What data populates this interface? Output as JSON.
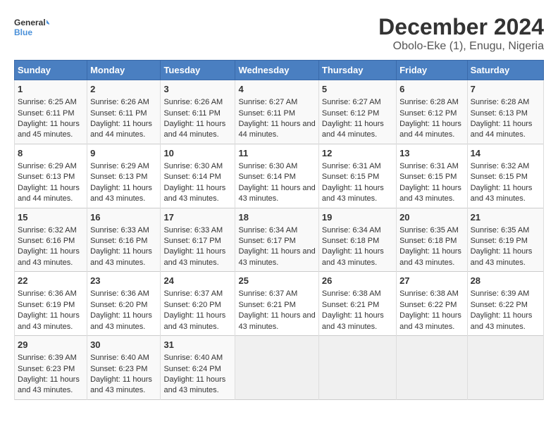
{
  "logo": {
    "text_general": "General",
    "text_blue": "Blue"
  },
  "title": "December 2024",
  "subtitle": "Obolo-Eke (1), Enugu, Nigeria",
  "header_days": [
    "Sunday",
    "Monday",
    "Tuesday",
    "Wednesday",
    "Thursday",
    "Friday",
    "Saturday"
  ],
  "weeks": [
    [
      {
        "day": "1",
        "info": "Sunrise: 6:25 AM\nSunset: 6:11 PM\nDaylight: 11 hours and 45 minutes."
      },
      {
        "day": "2",
        "info": "Sunrise: 6:26 AM\nSunset: 6:11 PM\nDaylight: 11 hours and 44 minutes."
      },
      {
        "day": "3",
        "info": "Sunrise: 6:26 AM\nSunset: 6:11 PM\nDaylight: 11 hours and 44 minutes."
      },
      {
        "day": "4",
        "info": "Sunrise: 6:27 AM\nSunset: 6:11 PM\nDaylight: 11 hours and 44 minutes."
      },
      {
        "day": "5",
        "info": "Sunrise: 6:27 AM\nSunset: 6:12 PM\nDaylight: 11 hours and 44 minutes."
      },
      {
        "day": "6",
        "info": "Sunrise: 6:28 AM\nSunset: 6:12 PM\nDaylight: 11 hours and 44 minutes."
      },
      {
        "day": "7",
        "info": "Sunrise: 6:28 AM\nSunset: 6:13 PM\nDaylight: 11 hours and 44 minutes."
      }
    ],
    [
      {
        "day": "8",
        "info": "Sunrise: 6:29 AM\nSunset: 6:13 PM\nDaylight: 11 hours and 44 minutes."
      },
      {
        "day": "9",
        "info": "Sunrise: 6:29 AM\nSunset: 6:13 PM\nDaylight: 11 hours and 43 minutes."
      },
      {
        "day": "10",
        "info": "Sunrise: 6:30 AM\nSunset: 6:14 PM\nDaylight: 11 hours and 43 minutes."
      },
      {
        "day": "11",
        "info": "Sunrise: 6:30 AM\nSunset: 6:14 PM\nDaylight: 11 hours and 43 minutes."
      },
      {
        "day": "12",
        "info": "Sunrise: 6:31 AM\nSunset: 6:15 PM\nDaylight: 11 hours and 43 minutes."
      },
      {
        "day": "13",
        "info": "Sunrise: 6:31 AM\nSunset: 6:15 PM\nDaylight: 11 hours and 43 minutes."
      },
      {
        "day": "14",
        "info": "Sunrise: 6:32 AM\nSunset: 6:15 PM\nDaylight: 11 hours and 43 minutes."
      }
    ],
    [
      {
        "day": "15",
        "info": "Sunrise: 6:32 AM\nSunset: 6:16 PM\nDaylight: 11 hours and 43 minutes."
      },
      {
        "day": "16",
        "info": "Sunrise: 6:33 AM\nSunset: 6:16 PM\nDaylight: 11 hours and 43 minutes."
      },
      {
        "day": "17",
        "info": "Sunrise: 6:33 AM\nSunset: 6:17 PM\nDaylight: 11 hours and 43 minutes."
      },
      {
        "day": "18",
        "info": "Sunrise: 6:34 AM\nSunset: 6:17 PM\nDaylight: 11 hours and 43 minutes."
      },
      {
        "day": "19",
        "info": "Sunrise: 6:34 AM\nSunset: 6:18 PM\nDaylight: 11 hours and 43 minutes."
      },
      {
        "day": "20",
        "info": "Sunrise: 6:35 AM\nSunset: 6:18 PM\nDaylight: 11 hours and 43 minutes."
      },
      {
        "day": "21",
        "info": "Sunrise: 6:35 AM\nSunset: 6:19 PM\nDaylight: 11 hours and 43 minutes."
      }
    ],
    [
      {
        "day": "22",
        "info": "Sunrise: 6:36 AM\nSunset: 6:19 PM\nDaylight: 11 hours and 43 minutes."
      },
      {
        "day": "23",
        "info": "Sunrise: 6:36 AM\nSunset: 6:20 PM\nDaylight: 11 hours and 43 minutes."
      },
      {
        "day": "24",
        "info": "Sunrise: 6:37 AM\nSunset: 6:20 PM\nDaylight: 11 hours and 43 minutes."
      },
      {
        "day": "25",
        "info": "Sunrise: 6:37 AM\nSunset: 6:21 PM\nDaylight: 11 hours and 43 minutes."
      },
      {
        "day": "26",
        "info": "Sunrise: 6:38 AM\nSunset: 6:21 PM\nDaylight: 11 hours and 43 minutes."
      },
      {
        "day": "27",
        "info": "Sunrise: 6:38 AM\nSunset: 6:22 PM\nDaylight: 11 hours and 43 minutes."
      },
      {
        "day": "28",
        "info": "Sunrise: 6:39 AM\nSunset: 6:22 PM\nDaylight: 11 hours and 43 minutes."
      }
    ],
    [
      {
        "day": "29",
        "info": "Sunrise: 6:39 AM\nSunset: 6:23 PM\nDaylight: 11 hours and 43 minutes."
      },
      {
        "day": "30",
        "info": "Sunrise: 6:40 AM\nSunset: 6:23 PM\nDaylight: 11 hours and 43 minutes."
      },
      {
        "day": "31",
        "info": "Sunrise: 6:40 AM\nSunset: 6:24 PM\nDaylight: 11 hours and 43 minutes."
      },
      {
        "day": "",
        "info": ""
      },
      {
        "day": "",
        "info": ""
      },
      {
        "day": "",
        "info": ""
      },
      {
        "day": "",
        "info": ""
      }
    ]
  ]
}
